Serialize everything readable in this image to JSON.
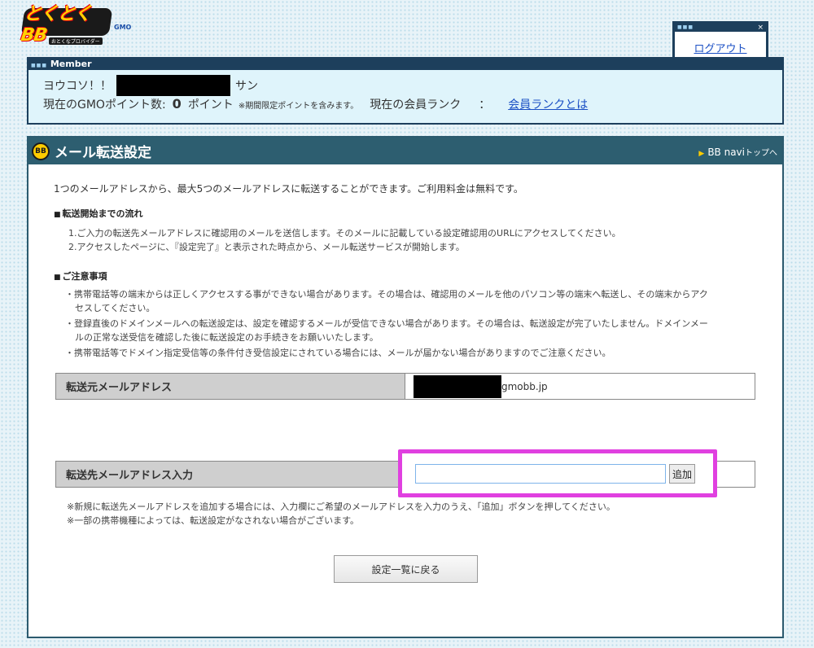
{
  "header": {
    "logo_mark": "とくとくBB",
    "logo_sub": "おとくなプロバイダー",
    "logo_gmo": "GMO",
    "logout_label": "ログアウト",
    "close_glyph": "×"
  },
  "member": {
    "heading": "Member",
    "greeting": "ヨウコソ！！",
    "greeting_suffix": "サン",
    "points_label": "現在のGMOポイント数:",
    "points_value": "0",
    "points_unit": "ポイント",
    "points_note": "※期間限定ポイントを含みます。",
    "rank_label": "現在の会員ランク",
    "rank_colon": "：",
    "rank_link": "会員ランクとは"
  },
  "main": {
    "icon_text": "BB",
    "title": "メール転送設定",
    "navi_label": "BB navi",
    "navi_suffix": "トップへ",
    "intro": "1つのメールアドレスから、最大5つのメールアドレスに転送することができます。ご利用料金は無料です。",
    "flow_title": "転送開始までの流れ",
    "flow_steps": [
      "1.ご入力の転送先メールアドレスに確認用のメールを送信します。そのメールに記載している設定確認用のURLにアクセスしてください。",
      "2.アクセスしたページに、『設定完了』と表示された時点から、メール転送サービスが開始します。"
    ],
    "notes_title": "ご注意事項",
    "notes": [
      "・携帯電話等の端末からは正しくアクセスする事ができない場合があります。その場合は、確認用のメールを他のパソコン等の端末へ転送し、その端末からアク",
      "セスしてください。",
      "・登録直後のドメインメールへの転送設定は、設定を確認するメールが受信できない場合があります。その場合は、転送設定が完了いたしません。ドメインメー",
      "ルの正常な送受信を確認した後に転送設定のお手続きをお願いいたします。",
      "・携帯電話等でドメイン指定受信等の条件付き受信設定にされている場合には、メールが届かない場合がありますのでご注意ください。"
    ],
    "source_label": "転送元メールアドレス",
    "source_domain": "gmobb.jp",
    "dest_label": "転送先メールアドレス入力",
    "dest_value": "",
    "add_label": "追加",
    "footnotes": [
      "※新規に転送先メールアドレスを追加する場合には、入力欄にご希望のメールアドレスを入力のうえ、「追加」ボタンを押してください。",
      "※一部の携帯機種によっては、転送設定がなされない場合がございます。"
    ],
    "back_label": "設定一覧に戻る"
  },
  "colors": {
    "panel_header": "#2d5e70",
    "member_bg": "#dff4fb",
    "highlight": "#e040e0",
    "link": "#1a4fc4"
  }
}
